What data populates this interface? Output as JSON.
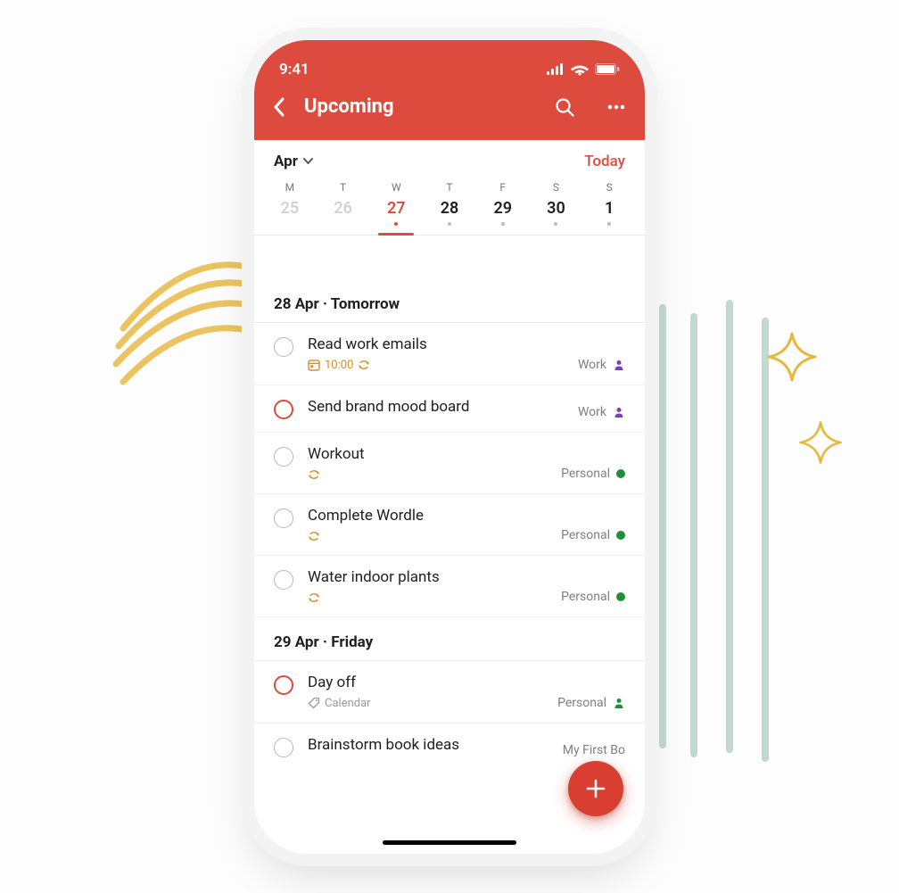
{
  "status": {
    "time": "9:41"
  },
  "nav": {
    "title": "Upcoming"
  },
  "month": {
    "label": "Apr",
    "today_link": "Today"
  },
  "week": {
    "dows": [
      "M",
      "T",
      "W",
      "T",
      "F",
      "S",
      "S"
    ],
    "nums": [
      "25",
      "26",
      "27",
      "28",
      "29",
      "30",
      "1"
    ]
  },
  "sections": [
    {
      "header": "28 Apr · Tomorrow",
      "tasks": [
        {
          "title": "Read work emails",
          "time": "10:00",
          "recurring": true,
          "calendar_icon": true,
          "priority": false,
          "project": "Work",
          "project_kind": "person-purple"
        },
        {
          "title": "Send brand mood board",
          "time": null,
          "recurring": false,
          "calendar_icon": false,
          "priority": true,
          "project": "Work",
          "project_kind": "person-purple"
        },
        {
          "title": "Workout",
          "time": null,
          "recurring": true,
          "calendar_icon": false,
          "priority": false,
          "project": "Personal",
          "project_kind": "dot-green"
        },
        {
          "title": "Complete Wordle",
          "time": null,
          "recurring": true,
          "calendar_icon": false,
          "priority": false,
          "project": "Personal",
          "project_kind": "dot-green"
        },
        {
          "title": "Water indoor plants",
          "time": null,
          "recurring": true,
          "calendar_icon": false,
          "priority": false,
          "project": "Personal",
          "project_kind": "dot-green"
        }
      ]
    },
    {
      "header": "29 Apr · Friday",
      "tasks": [
        {
          "title": "Day off",
          "label": "Calendar",
          "priority": true,
          "project": "Personal",
          "project_kind": "person-green"
        },
        {
          "title": "Brainstorm book ideas",
          "label": null,
          "priority": false,
          "project": "My First Bo",
          "project_kind": "none"
        }
      ]
    }
  ],
  "colors": {
    "accent": "#dd4b3e",
    "amber": "#d6902b",
    "green": "#1f8f3a",
    "purple": "#7a3fb8"
  }
}
